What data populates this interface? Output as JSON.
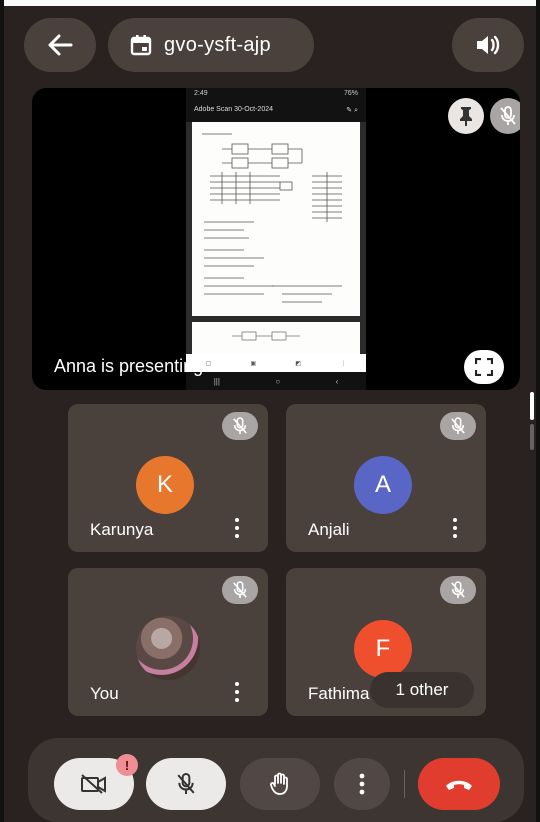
{
  "header": {
    "meeting_code": "gvo-ysft-ajp"
  },
  "stage": {
    "presenter_label": "Anna is presenting",
    "phone_status_time": "2:49",
    "phone_status_right": "76%",
    "phone_doc_title": "Adobe Scan 30-Oct-2024"
  },
  "participants": [
    {
      "name": "Karunya",
      "initial": "K",
      "color": "#e8772e",
      "muted": true
    },
    {
      "name": "Anjali",
      "initial": "A",
      "color": "#5966c6",
      "muted": true
    },
    {
      "name": "You",
      "initial": "",
      "color": "",
      "muted": true
    },
    {
      "name": "Fathima",
      "initial": "F",
      "color": "#ef4f2c",
      "muted": true
    }
  ],
  "overflow_label": "1 other",
  "controls": {
    "camera_alert": "!"
  },
  "colors": {
    "end_call": "#e03d2f",
    "background": "#2a2220",
    "tile": "#4a403c"
  }
}
